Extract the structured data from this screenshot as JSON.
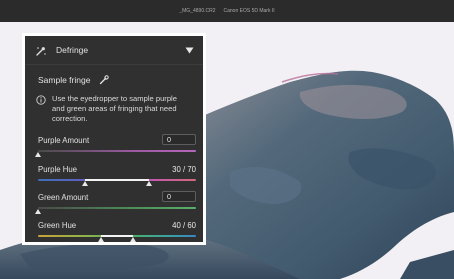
{
  "titlebar": {
    "filename": "_MG_4890.CR2",
    "camera": "Canon EOS 5D Mark II"
  },
  "panel": {
    "title": "Defringe",
    "sample_label": "Sample fringe",
    "info_text": "Use the eyedropper to sample purple and green areas of fringing that need correction.",
    "purple_amount": {
      "label": "Purple Amount",
      "value": "0",
      "level": 0.0
    },
    "purple_hue": {
      "label": "Purple Hue",
      "value": "30 / 70",
      "range": [
        30,
        70
      ],
      "min": 0,
      "max": 100
    },
    "green_amount": {
      "label": "Green Amount",
      "value": "0",
      "level": 0.0
    },
    "green_hue": {
      "label": "Green Hue",
      "value": "40 / 60",
      "range": [
        40,
        60
      ],
      "min": 0,
      "max": 100
    }
  },
  "colors": {
    "panel_bg": "#303030",
    "panel_border": "#ffffff",
    "purple_accent": "#b45ab4",
    "green_accent": "#4ca05a"
  },
  "icons": [
    "eyedropper-sparkle-icon",
    "chevron-down-icon",
    "eyedropper-icon",
    "info-icon"
  ]
}
